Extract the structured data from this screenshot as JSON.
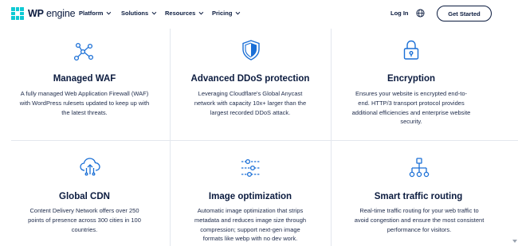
{
  "brand": {
    "name_bold": "WP",
    "name_rest": " engine",
    "color": "#0ecad4"
  },
  "nav": {
    "items": [
      "Platform",
      "Solutions",
      "Resources",
      "Pricing"
    ],
    "login": "Log In",
    "cta": "Get Started"
  },
  "colors": {
    "text": "#0b1b3f",
    "icon": "#1a6fd6",
    "divider": "#e3e7ee"
  },
  "features": [
    {
      "icon": "network-nodes-icon",
      "title": "Managed WAF",
      "lines": [
        "A fully managed Web Application Firewall (WAF)",
        "with WordPress rulesets updated to keep up with",
        "the latest threats."
      ]
    },
    {
      "icon": "shield-icon",
      "title": "Advanced DDoS protection",
      "lines": [
        "Leveraging Cloudflare's Global Anycast",
        "network with capacity 10x+ larger than the",
        "largest recorded DDoS attack."
      ]
    },
    {
      "icon": "padlock-icon",
      "title": "Encryption",
      "lines": [
        "Ensures your website is encrypted end-to-",
        "end. HTTP/3 transport protocol provides",
        "additional efficiencies and enterprise website",
        "security."
      ]
    },
    {
      "icon": "cloud-upload-icon",
      "title": "Global CDN",
      "lines": [
        "Content Delivery Network offers over 250",
        "points of presence across 300 cities in 100",
        "countries."
      ]
    },
    {
      "icon": "sliders-icon",
      "title": "Image optimization",
      "lines": [
        "Automatic image optimization that strips",
        "metadata and reduces image size through",
        "compression; support next-gen image",
        "formats like webp with no dev work."
      ]
    },
    {
      "icon": "routing-tree-icon",
      "title": "Smart traffic routing",
      "lines": [
        "Real-time traffic routing for your web traffic to",
        "avoid congestion and ensure the most consistent",
        "performance for visitors."
      ]
    }
  ]
}
